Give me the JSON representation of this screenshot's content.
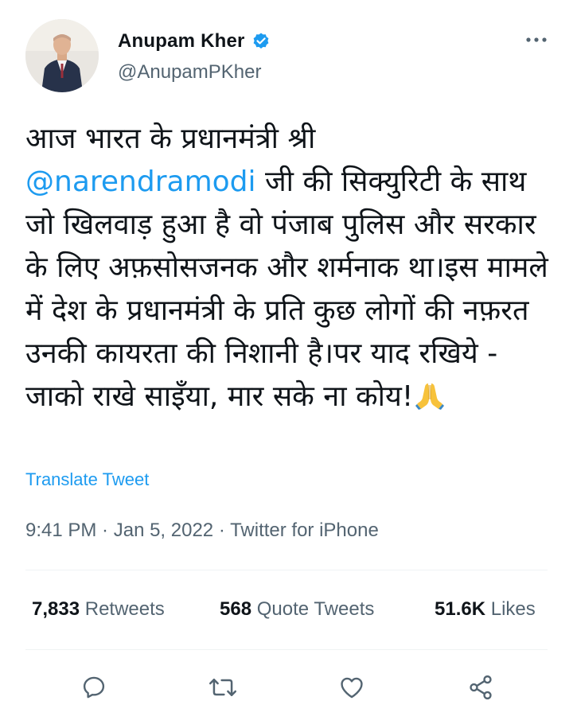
{
  "user": {
    "display_name": "Anupam Kher",
    "handle": "@AnupamPKher",
    "verified": true,
    "avatar_icon": "avatar-photo"
  },
  "menu": {
    "icon": "more-dots-icon"
  },
  "tweet": {
    "text_before": "आज भारत के प्रधानमंत्री श्री ",
    "mention": "@narendramodi",
    "text_after": " जी की सिक्युरिटी के साथ जो खिलवाड़ हुआ है वो पंजाब पुलिस और सरकार के लिए अफ़सोसजनक और शर्मनाक था।इस मामले में देश के प्रधानमंत्री के प्रति कुछ लोगों की नफ़रत उनकी कायरता की निशानी है।पर याद रखिये - जाको राखे साइँया, मार सके ना कोय!",
    "emoji": "folded-hands"
  },
  "translate_label": "Translate Tweet",
  "meta": {
    "time": "9:41 PM",
    "sep1": " · ",
    "date": "Jan 5, 2022",
    "sep2": " · ",
    "source": "Twitter for iPhone"
  },
  "stats": {
    "retweets_count": "7,833",
    "retweets_label": "Retweets",
    "quotes_count": "568",
    "quotes_label": "Quote Tweets",
    "likes_count": "51.6K",
    "likes_label": "Likes"
  },
  "actions": {
    "reply_icon": "reply-icon",
    "retweet_icon": "retweet-icon",
    "like_icon": "like-icon",
    "share_icon": "share-icon"
  },
  "colors": {
    "accent": "#1d9bf0",
    "text": "#0f1419",
    "secondary": "#536471",
    "divider": "#eff3f4",
    "verified": "#1d9bf0"
  }
}
